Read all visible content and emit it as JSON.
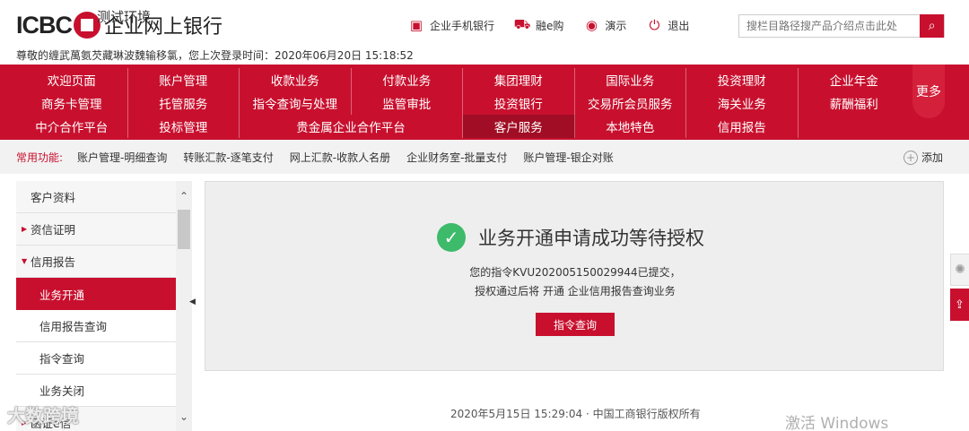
{
  "header": {
    "logo_text": "ICBC",
    "logo_title": "企业网上银行",
    "test_env": "测试环境",
    "welcome": "尊敬的缠武萬氨芡藏琳波魏输移氯，您上次登录时间：2020年06月20日 15:18:52",
    "links": [
      {
        "label": "企业手机银行",
        "icon": "mobile-bank-icon"
      },
      {
        "label": "融e购",
        "icon": "cart-icon"
      },
      {
        "label": "演示",
        "icon": "demo-icon"
      },
      {
        "label": "退出",
        "icon": "power-icon"
      }
    ],
    "search_placeholder": "搜栏目路径搜产品介绍点击此处"
  },
  "nav": {
    "row1": [
      "欢迎页面",
      "账户管理",
      "收款业务",
      "付款业务",
      "集团理财",
      "国际业务",
      "投资理财",
      "企业年金"
    ],
    "row2": [
      "商务卡管理",
      "托管服务",
      "指令查询与处理",
      "监管审批",
      "投资银行",
      "交易所会员服务",
      "海关业务",
      "薪酬福利"
    ],
    "row3": [
      "中介合作平台",
      "投标管理",
      "贵金属企业合作平台",
      "客户服务",
      "本地特色",
      "信用报告"
    ],
    "more": "更多"
  },
  "quick": {
    "label": "常用功能:",
    "items": [
      "账户管理-明细查询",
      "转账汇款-逐笔支付",
      "网上汇款-收款人名册",
      "企业财务室-批量支付",
      "账户管理-银企对账"
    ],
    "add": "添加"
  },
  "sidebar": {
    "items": [
      {
        "label": "客户资料",
        "type": "top"
      },
      {
        "label": "资信证明",
        "type": "group"
      },
      {
        "label": "信用报告",
        "type": "group-open"
      },
      {
        "label": "业务开通",
        "type": "sub-active"
      },
      {
        "label": "信用报告查询",
        "type": "sub"
      },
      {
        "label": "指令查询",
        "type": "sub"
      },
      {
        "label": "业务关闭",
        "type": "sub"
      },
      {
        "label": "函证e信",
        "type": "group"
      }
    ]
  },
  "content": {
    "success_title": "业务开通申请成功等待授权",
    "message1": "您的指令KVU202005150029944已提交，",
    "message2": "授权通过后将 开通 企业信用报告查询业务",
    "query_button": "指令查询"
  },
  "footer": {
    "text": "2020年5月15日 15:29:04 · 中国工商银行版权所有"
  },
  "watermarks": {
    "windows": "激活 Windows",
    "source": "大数跨境"
  },
  "colors": {
    "brand_red": "#c8102e",
    "success_green": "#3dba6a"
  }
}
